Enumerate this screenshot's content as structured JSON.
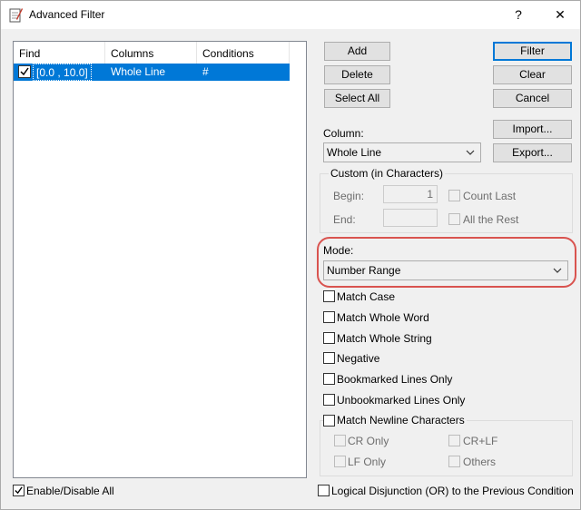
{
  "window": {
    "title": "Advanced Filter",
    "help_glyph": "?",
    "close_glyph": "✕"
  },
  "list": {
    "columns": [
      "Find",
      "Columns",
      "Conditions"
    ],
    "rows": [
      {
        "checked": true,
        "find": "[0.0 , 10.0]",
        "columns": "Whole Line",
        "conditions": "#"
      }
    ]
  },
  "buttons": {
    "add": "Add",
    "delete": "Delete",
    "select_all": "Select All",
    "filter": "Filter",
    "clear": "Clear",
    "cancel": "Cancel",
    "import": "Import...",
    "export": "Export..."
  },
  "column": {
    "label": "Column:",
    "value": "Whole Line"
  },
  "custom": {
    "group_label": "Custom (in Characters)",
    "begin_label": "Begin:",
    "begin_value": "1",
    "end_label": "End:",
    "end_value": "",
    "count_last": "Count Last",
    "all_the_rest": "All the Rest"
  },
  "mode": {
    "label": "Mode:",
    "value": "Number Range"
  },
  "options": {
    "match_case": "Match Case",
    "match_whole_word": "Match Whole Word",
    "match_whole_string": "Match Whole String",
    "negative": "Negative",
    "bookmarked": "Bookmarked Lines Only",
    "unbookmarked": "Unbookmarked Lines Only",
    "match_newline": "Match Newline Characters",
    "cr_only": "CR Only",
    "crlf": "CR+LF",
    "lf_only": "LF Only",
    "others": "Others"
  },
  "footer": {
    "enable_disable_all": "Enable/Disable All",
    "logical_disjunction": "Logical Disjunction (OR) to the Previous Condition"
  },
  "colors": {
    "selection": "#0078d7",
    "highlight_ring": "#d9534f"
  }
}
